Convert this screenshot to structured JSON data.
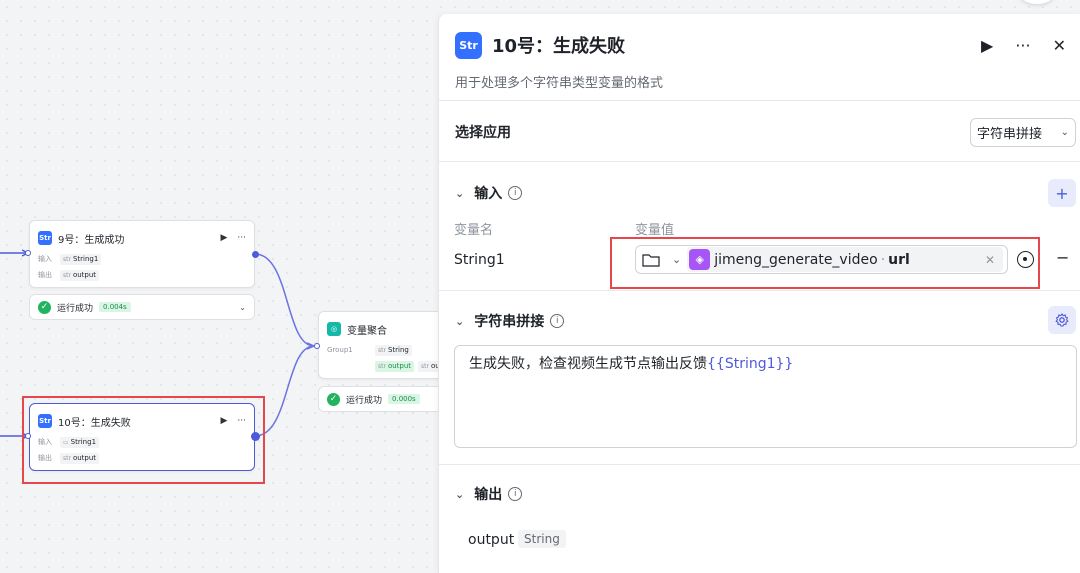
{
  "canvas": {
    "node9": {
      "title": "9号：生成成功",
      "input_label": "输入",
      "output_label": "输出",
      "input_type": "str",
      "input_var": "String1",
      "output_type": "str",
      "output_var": "output",
      "status": "运行成功",
      "time": "0.004s"
    },
    "node10": {
      "title": "10号：生成失败",
      "input_label": "输入",
      "output_label": "输出",
      "input_var": "String1",
      "output_type": "str",
      "output_var": "output"
    },
    "aggregate": {
      "title": "变量聚合",
      "group_label": "Group1",
      "group_type": "str",
      "group_var": "String",
      "output_var": "output",
      "output_type2": "str",
      "output_trunc": "ou",
      "status": "运行成功",
      "time": "0.000s"
    }
  },
  "panel": {
    "icon_text": "Str",
    "title": "10号：生成失败",
    "description": "用于处理多个字符串类型变量的格式",
    "app_select_label": "选择应用",
    "app_select_value": "字符串拼接",
    "input_section": "输入",
    "col_var_name": "变量名",
    "col_var_value": "变量值",
    "input_var_name": "String1",
    "ref_node": "jimeng_generate_video",
    "ref_sep": "·",
    "ref_field": "url",
    "concat_section": "字符串拼接",
    "template_text": "生成失败，检查视频生成节点输出反馈",
    "template_var": "{{String1}}",
    "output_section": "输出",
    "output_name": "output",
    "output_type": "String"
  },
  "colors": {
    "accent": "#4e5bd8",
    "success": "#22b35e",
    "highlight": "#e5474b",
    "node_icon": "#3370ff"
  }
}
